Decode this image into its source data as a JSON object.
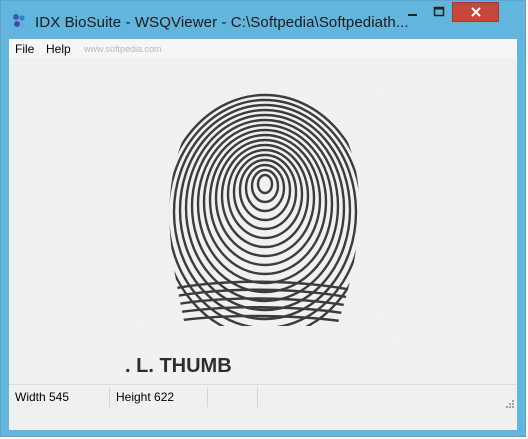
{
  "window": {
    "title": "IDX BioSuite - WSQViewer - C:\\Softpedia\\Softpediath...",
    "colors": {
      "frame": "#62b6de",
      "close": "#c7473d",
      "client": "#f0f0f0"
    }
  },
  "menu": {
    "file_label": "File",
    "help_label": "Help"
  },
  "watermark": "www.softpedia.com",
  "image": {
    "caption": ". L. THUMB",
    "icon": "fingerprint-image"
  },
  "status": {
    "width_text": "Width 545",
    "height_text": "Height 622",
    "extra_text": ""
  },
  "icons": [
    "app-icon",
    "minimize-icon",
    "maximize-icon",
    "close-icon",
    "resize-grip-icon"
  ]
}
